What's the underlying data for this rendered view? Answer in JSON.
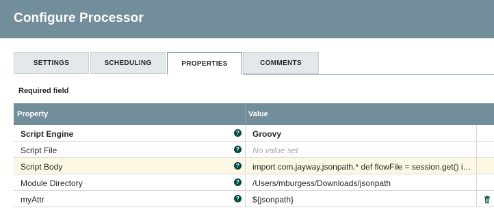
{
  "header": {
    "title": "Configure Processor"
  },
  "tabs": [
    {
      "label": "SETTINGS"
    },
    {
      "label": "SCHEDULING"
    },
    {
      "label": "PROPERTIES"
    },
    {
      "label": "COMMENTS"
    }
  ],
  "active_tab": "PROPERTIES",
  "required_label": "Required field",
  "table": {
    "columns": {
      "property": "Property",
      "value": "Value"
    },
    "rows": [
      {
        "name": "Script Engine",
        "value": "Groovy"
      },
      {
        "name": "Script File",
        "value": "No value set"
      },
      {
        "name": "Script Body",
        "value": "import com.jayway.jsonpath.* def flowFile = session.get() if(…"
      },
      {
        "name": "Module Directory",
        "value": "/Users/mburgess/Downloads/jsonpath"
      },
      {
        "name": "myAttr",
        "value": "${jsonpath}"
      }
    ]
  },
  "colors": {
    "header_bg": "#728e9b",
    "tab_bg": "#e3e8eb",
    "highlight_row": "#fcf8e3",
    "help_icon": "#004849",
    "trash_icon": "#004849"
  },
  "icons": {
    "help": "help-circle-icon",
    "delete": "trash-icon"
  }
}
